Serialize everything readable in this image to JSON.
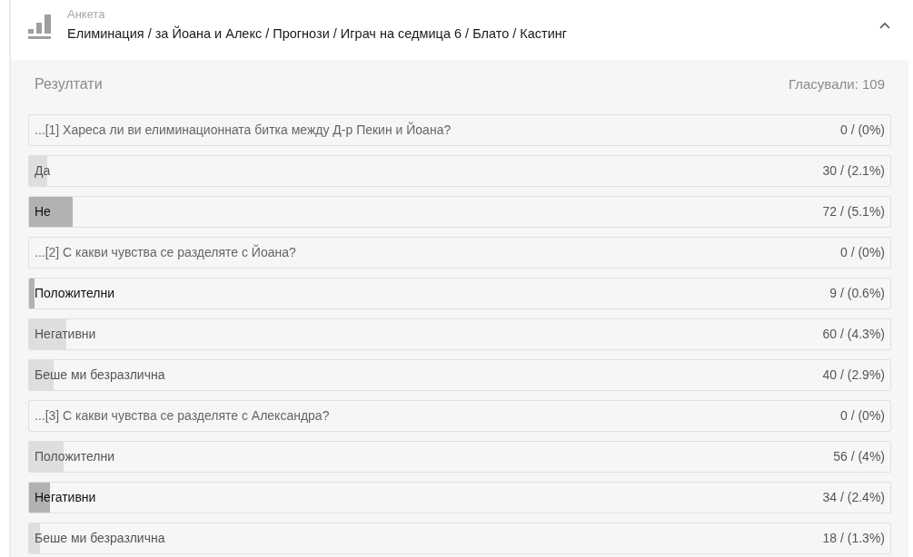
{
  "header": {
    "type_label": "Анкета",
    "breadcrumb": "Елиминация / за Йоана и Алекс / Прогнози / Играч на седмица 6 / Блато / Кастинг",
    "expanded": true
  },
  "results": {
    "title": "Резултати",
    "votes": "Гласували: 109"
  },
  "questions": [
    {
      "text": "...[1] Хареса ли ви елиминационната битка между Д-р Пекин и Йоана?",
      "count": "0 / (0%)",
      "options": [
        {
          "label": "Да",
          "count": "30 / (2.1%)",
          "level": 0.021,
          "selected": false
        },
        {
          "label": "Не",
          "count": "72 / (5.1%)",
          "level": 0.051,
          "selected": true
        }
      ]
    },
    {
      "text": "...[2] С какви чувства се разделяте с Йоана?",
      "count": "0 / (0%)",
      "options": [
        {
          "label": "Положителни",
          "count": "9 / (0.6%)",
          "level": 0.006,
          "selected": true
        },
        {
          "label": "Негативни",
          "count": "60 / (4.3%)",
          "level": 0.043,
          "selected": false
        },
        {
          "label": "Беше ми безразлична",
          "count": "40 / (2.9%)",
          "level": 0.029,
          "selected": false
        }
      ]
    },
    {
      "text": "...[3] С какви чувства се разделяте с Александра?",
      "count": "0 / (0%)",
      "options": [
        {
          "label": "Положителни",
          "count": "56 / (4%)",
          "level": 0.04,
          "selected": false
        },
        {
          "label": "Негативни",
          "count": "34 / (2.4%)",
          "level": 0.024,
          "selected": true
        },
        {
          "label": "Беше ми безразлична",
          "count": "18 / (1.3%)",
          "level": 0.013,
          "selected": false
        }
      ]
    }
  ]
}
